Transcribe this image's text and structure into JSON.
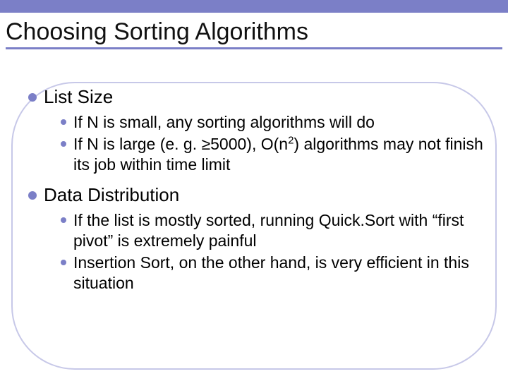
{
  "title": "Choosing Sorting Algorithms",
  "sections": [
    {
      "heading": "List Size",
      "items": [
        {
          "text": "If N is small, any sorting algorithms will do"
        },
        {
          "html": "If N is large (e. g. ≥5000), O(n<sup>2</sup>) algorithms may not finish its job within time limit"
        }
      ]
    },
    {
      "heading": "Data Distribution",
      "items": [
        {
          "text": "If the list is mostly sorted, running Quick.Sort with “first pivot” is extremely painful"
        },
        {
          "text": "Insertion Sort, on the other hand, is very efficient in this situation"
        }
      ]
    }
  ]
}
